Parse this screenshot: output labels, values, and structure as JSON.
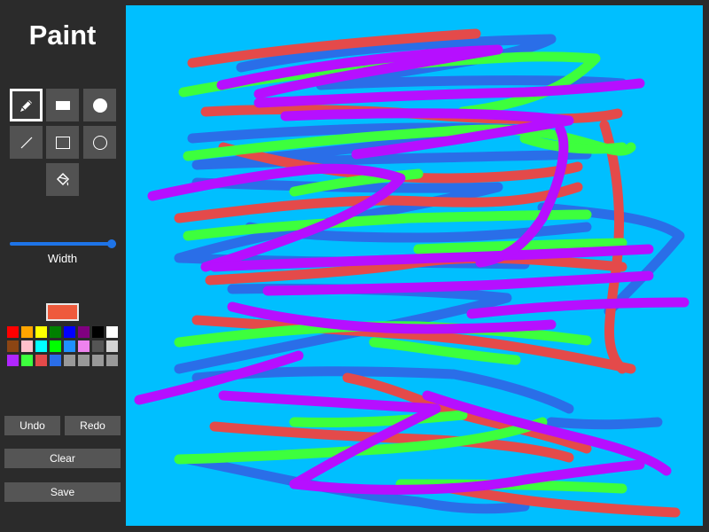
{
  "app": {
    "title": "Paint"
  },
  "tools": [
    {
      "name": "brush",
      "icon": "pencil-icon",
      "active": true
    },
    {
      "name": "filled-rectangle",
      "icon": "filled-rectangle-icon",
      "active": false
    },
    {
      "name": "filled-circle",
      "icon": "filled-circle-icon",
      "active": false
    },
    {
      "name": "line",
      "icon": "line-icon",
      "active": false
    },
    {
      "name": "rectangle",
      "icon": "rectangle-outline-icon",
      "active": false
    },
    {
      "name": "circle",
      "icon": "circle-outline-icon",
      "active": false
    },
    {
      "name": "fill",
      "icon": "paint-bucket-icon",
      "active": false
    }
  ],
  "width_control": {
    "label": "Width",
    "value_fraction": 1.0
  },
  "current_color": "#ef5a3c",
  "palette": [
    "#ff0000",
    "#ffa500",
    "#ffff00",
    "#008000",
    "#0000ff",
    "#800080",
    "#000000",
    "#ffffff",
    "#8b4513",
    "#ffc0cb",
    "#00ffff",
    "#00ff00",
    "#1e90ff",
    "#ee82ee",
    "#555555",
    "#d3d3d3",
    "#b026ff",
    "#3dff3d",
    "#e44a4a",
    "#2a6ee8",
    "#999999",
    "#999999",
    "#999999",
    "#999999"
  ],
  "buttons": {
    "undo": "Undo",
    "redo": "Redo",
    "clear": "Clear",
    "save": "Save"
  },
  "canvas": {
    "background": "#00bfff",
    "stroke_colors": {
      "blue": "#2a6ee8",
      "red": "#e44a4a",
      "green": "#3dff3d",
      "purple": "#b60fff"
    }
  }
}
